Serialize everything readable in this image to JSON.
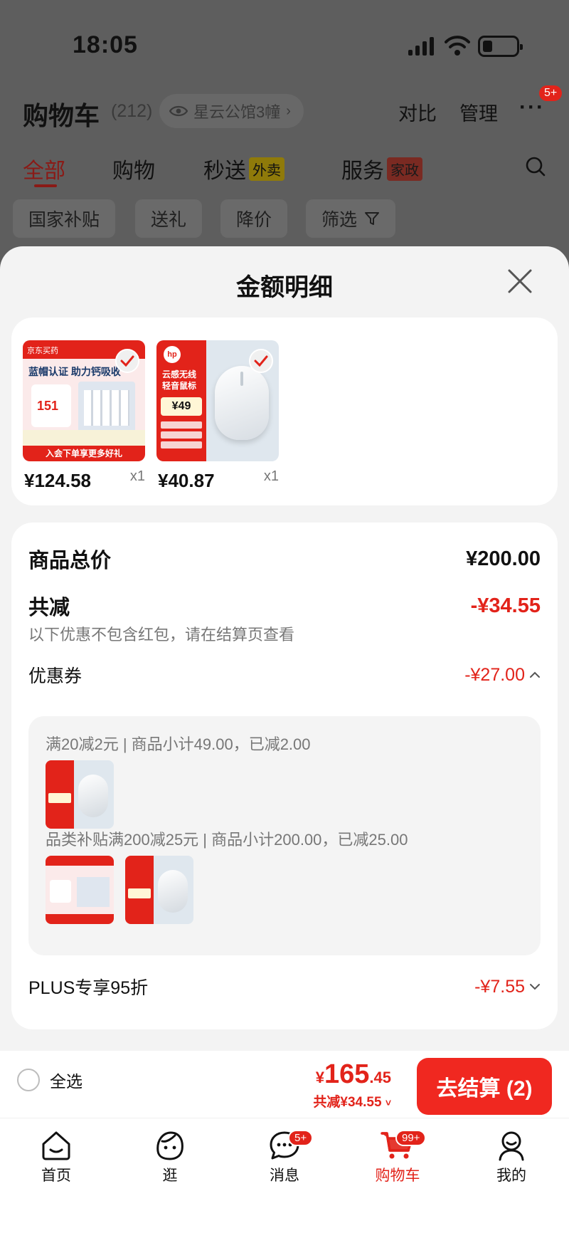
{
  "status_bar": {
    "time": "18:05"
  },
  "header": {
    "title": "购物车",
    "count": "(212)",
    "location": "星云公馆3幢",
    "compare": "对比",
    "manage": "管理",
    "more_badge": "5+"
  },
  "tabs": [
    {
      "label": "全部",
      "active": true
    },
    {
      "label": "购物"
    },
    {
      "label": "秒送",
      "tag": "外卖"
    },
    {
      "label": "服务",
      "tag": "家政"
    }
  ],
  "chips": [
    "国家补贴",
    "送礼",
    "降价",
    "筛选"
  ],
  "sheet": {
    "title": "金额明细",
    "products": [
      {
        "price": "¥124.58",
        "qty": "x1",
        "img_brand": "京东买药",
        "img_headline": "蓝帽认证 助力钙吸收",
        "img_price": "151",
        "img_footer": "入会下单享更多好礼"
      },
      {
        "price": "¥40.87",
        "qty": "x1",
        "img_brand": "hp",
        "img_headline": "云感无线 轻音鼠标",
        "img_price": "¥49",
        "img_lines": [
          "10米稳定连接",
          "三档DPI可调",
          "磁吸收纳仓"
        ]
      }
    ],
    "summary": {
      "total_label": "商品总价",
      "total_value": "¥200.00",
      "discount_label": "共减",
      "discount_value": "-¥34.55",
      "discount_note": "以下优惠不包含红包，请在结算页查看"
    },
    "coupon": {
      "label": "优惠券",
      "value": "-¥27.00",
      "rules": [
        "满20减2元 | 商品小计49.00，已减2.00",
        "品类补贴满200减25元 | 商品小计200.00，已减25.00"
      ]
    },
    "plus": {
      "label": "PLUS专享95折",
      "value": "-¥7.55"
    }
  },
  "footer": {
    "select_all": "全选",
    "currency": "¥",
    "total_int": "165",
    "total_dec": ".45",
    "total_discount": "共减¥34.55",
    "checkout": "去结算 (2)"
  },
  "tabbar": [
    {
      "label": "首页",
      "icon": "home-icon"
    },
    {
      "label": "逛",
      "icon": "explore-icon"
    },
    {
      "label": "消息",
      "icon": "message-icon",
      "badge": "5+"
    },
    {
      "label": "购物车",
      "icon": "cart-icon",
      "badge": "99+",
      "active": true
    },
    {
      "label": "我的",
      "icon": "profile-icon"
    }
  ],
  "colors": {
    "accent": "#e2231a",
    "checkout": "#f02820"
  }
}
